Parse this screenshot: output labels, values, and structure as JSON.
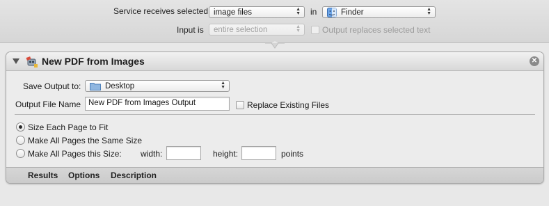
{
  "service": {
    "receives_label": "Service receives selected",
    "input_type": "image files",
    "in_label": "in",
    "application": "Finder",
    "input_is_label": "Input is",
    "input_is_value": "entire selection",
    "replaces_label": "Output replaces selected text"
  },
  "action": {
    "title": "New PDF from Images",
    "save_output_label": "Save Output to:",
    "save_output_value": "Desktop",
    "file_name_label": "Output File Name",
    "file_name_value": "New PDF from Images Output",
    "replace_label": "Replace Existing Files",
    "options": [
      {
        "label": "Size Each Page to Fit",
        "selected": true
      },
      {
        "label": "Make All Pages the Same Size",
        "selected": false
      },
      {
        "label": "Make All Pages this Size:",
        "selected": false
      }
    ],
    "width_label": "width:",
    "width_value": "",
    "height_label": "height:",
    "height_value": "",
    "units_label": "points",
    "footer_tabs": [
      "Results",
      "Options",
      "Description"
    ]
  }
}
